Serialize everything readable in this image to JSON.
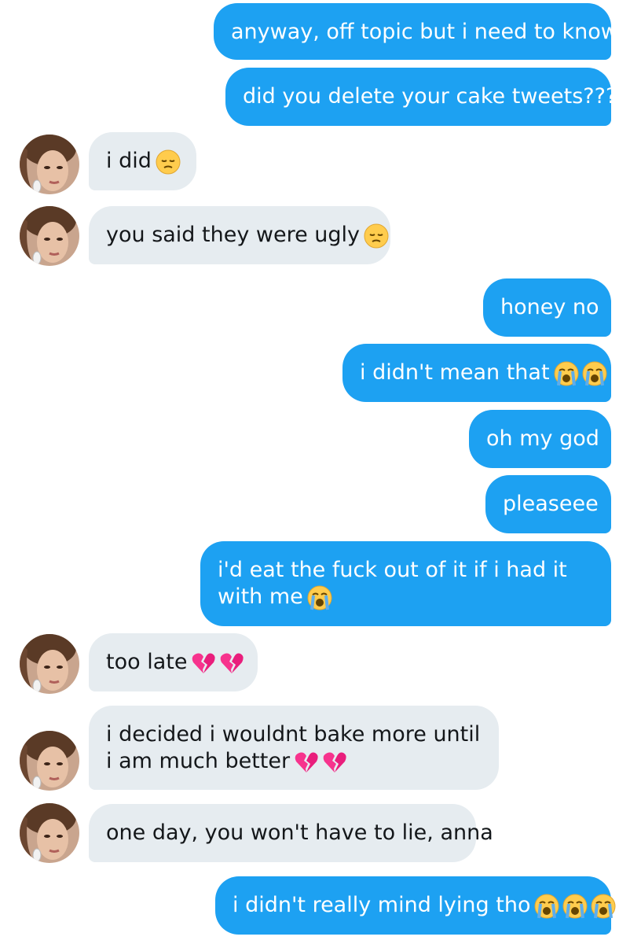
{
  "messages": [
    {
      "side": "out",
      "text": "anyway, off topic but i need to know",
      "emojis": []
    },
    {
      "side": "out",
      "text": "did you delete your cake tweets???",
      "emojis": []
    },
    {
      "side": "in",
      "text": "i did",
      "emojis": [
        "pensive-face"
      ]
    },
    {
      "side": "in",
      "text": "you said they were ugly",
      "emojis": [
        "pensive-face"
      ]
    },
    {
      "side": "out",
      "text": "honey no",
      "emojis": []
    },
    {
      "side": "out",
      "text": "i didn't mean that",
      "emojis": [
        "loudly-crying-face",
        "loudly-crying-face"
      ]
    },
    {
      "side": "out",
      "text": "oh my god",
      "emojis": []
    },
    {
      "side": "out",
      "text": "pleaseee",
      "emojis": []
    },
    {
      "side": "out",
      "text": "i'd eat the fuck out of it if i had it with me",
      "emojis": [
        "loudly-crying-face"
      ]
    },
    {
      "side": "in",
      "text": "too late",
      "emojis": [
        "broken-heart",
        "broken-heart"
      ]
    },
    {
      "side": "in",
      "text": "i decided i wouldnt bake more until i am much better",
      "emojis": [
        "broken-heart",
        "broken-heart"
      ]
    },
    {
      "side": "in",
      "text": "one day, you won't have to lie, anna",
      "emojis": []
    },
    {
      "side": "out",
      "text": "i didn't really mind lying tho",
      "emojis": [
        "loudly-crying-face",
        "loudly-crying-face",
        "loudly-crying-face"
      ]
    }
  ],
  "colors": {
    "outgoing_bubble": "#1da1f2",
    "incoming_bubble": "#e6ecf0",
    "incoming_text": "#14171a",
    "outgoing_text": "#ffffff"
  },
  "avatar_icon": "contact-avatar"
}
